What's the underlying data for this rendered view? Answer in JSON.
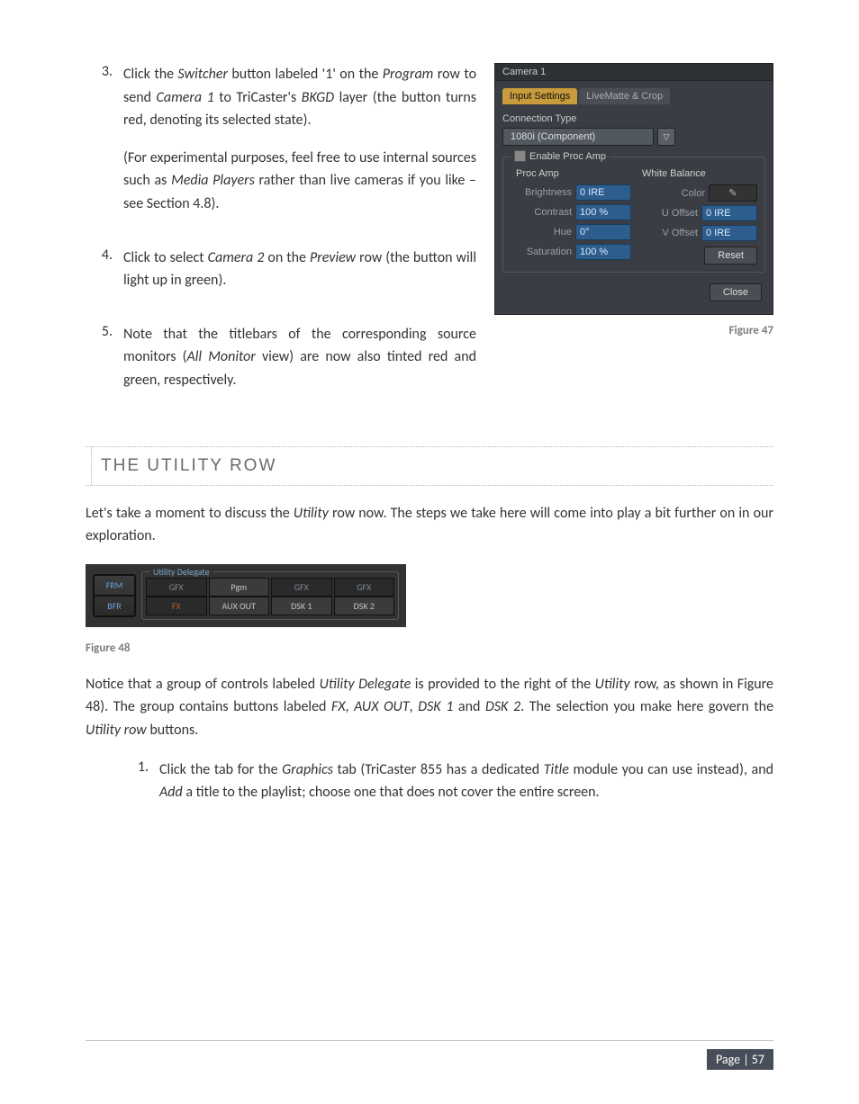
{
  "steps_top": {
    "s3num": "3.",
    "s3a": "Click the ",
    "s3b": "Switcher",
    "s3c": " button labeled '1' on the ",
    "s3d": "Program",
    "s3e": " row to send ",
    "s3f": "Camera 1",
    "s3g": " to TriCaster's ",
    "s3h": "BKGD",
    "s3i": " layer (the button turns red, denoting its selected state).",
    "s3p2a": "(For experimental purposes, feel free to use internal sources such as ",
    "s3p2b": "Media Players",
    "s3p2c": " rather than live cameras if you like – see Section 4.8).",
    "s4num": "4.",
    "s4a": "Click to select ",
    "s4b": "Camera 2",
    "s4c": " on the ",
    "s4d": "Preview",
    "s4e": " row (the button will light up in green).",
    "s5num": "5.",
    "s5a": "Note that the titlebars of the corresponding source monitors (",
    "s5b": "All Monitor",
    "s5c": " view) are now also tinted red and green, respectively."
  },
  "fig47": "Figure 47",
  "dlg": {
    "title": "Camera 1",
    "tab1": "Input Settings",
    "tab2": "LiveMatte & Crop",
    "conntype": "Connection Type",
    "dd": "1080i (Component)",
    "dd_arrow": "▽",
    "enable": "Enable Proc Amp",
    "procamp": "Proc Amp",
    "whitebal": "White Balance",
    "brightness_l": "Brightness",
    "brightness_v": "0 IRE",
    "contrast_l": "Contrast",
    "contrast_v": "100 %",
    "hue_l": "Hue",
    "hue_v": "0°",
    "saturation_l": "Saturation",
    "saturation_v": "100 %",
    "color_l": "Color",
    "uoff_l": "U Offset",
    "uoff_v": "0 IRE",
    "voff_l": "V Offset",
    "voff_v": "0 IRE",
    "reset": "Reset",
    "close": "Close"
  },
  "section_heading": "THE UTILITY ROW",
  "para1a": " Let's take a moment to discuss the ",
  "para1b": "Utility",
  "para1c": " row now.  The steps we take here will come into play a bit further on in our exploration.",
  "ud": {
    "grp_title": "Utility Delegate",
    "frm": "FRM",
    "bfr": "BFR",
    "r1": {
      "a": "GFX",
      "b": "Pgm",
      "c": "GFX",
      "d": "GFX"
    },
    "r2": {
      "a": "FX",
      "b": "AUX OUT",
      "c": "DSK 1",
      "d": "DSK 2"
    }
  },
  "fig48": "Figure 48",
  "para2a": "Notice that a group of controls labeled ",
  "para2b": "Utility Delegate",
  "para2c": " is provided to the right of the ",
  "para2d": "Utility",
  "para2e": " row, as shown in Figure 48).   The group contains buttons labeled ",
  "para2f": "FX",
  "para2g": ", ",
  "para2h": "AUX OUT",
  "para2i": ", ",
  "para2j": "DSK 1",
  "para2k": " and ",
  "para2l": "DSK 2",
  "para2m": ". The selection you make here govern the ",
  "para2n": "Utility row",
  "para2o": " buttons.",
  "step_bottom": {
    "num": "1.",
    "a": "Click the tab for the ",
    "b": "Graphics",
    "c": " tab (TriCaster 855 has a dedicated ",
    "d": "Title",
    "e": " module you can use instead), and ",
    "f": "Add",
    "g": " a title to the playlist; choose one that does not cover the entire screen."
  },
  "page_label": "Page | 57"
}
